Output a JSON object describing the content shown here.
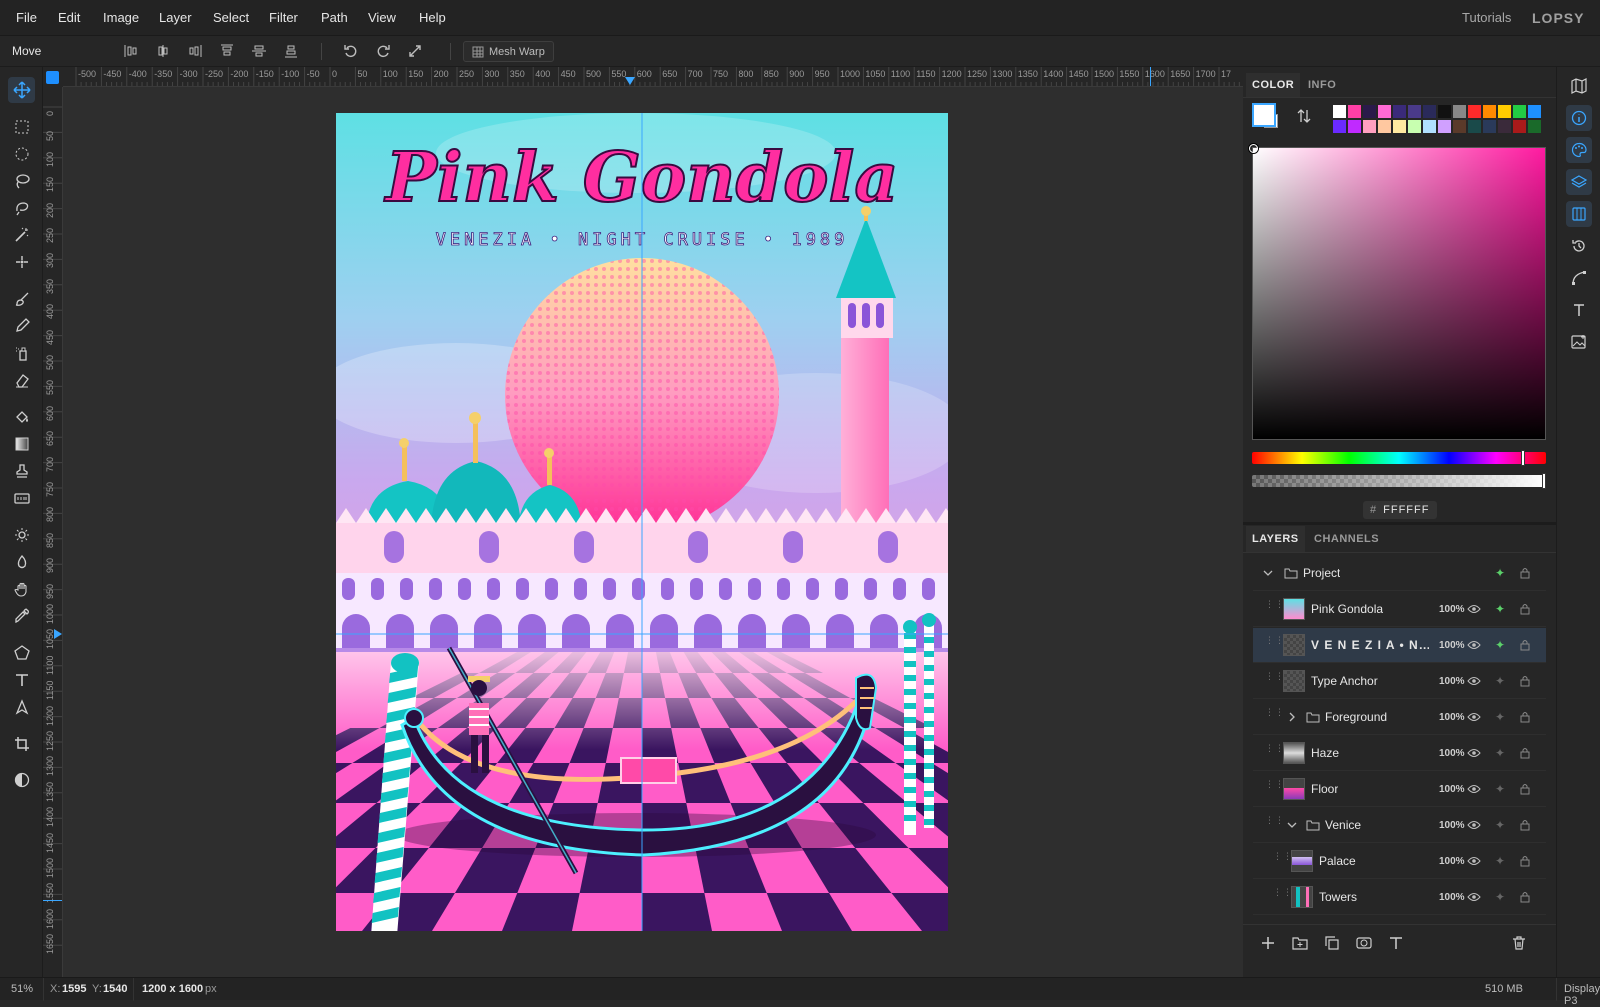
{
  "menu": {
    "items": [
      "File",
      "Edit",
      "Image",
      "Layer",
      "Select",
      "Filter",
      "Path",
      "View",
      "Help"
    ],
    "tutorials": "Tutorials",
    "brand": "LOPSY"
  },
  "options": {
    "tool_name": "Move",
    "mesh_warp": "Mesh Warp"
  },
  "rulers": {
    "h_ticks": [
      "-500",
      "-450",
      "-400",
      "-350",
      "-300",
      "-250",
      "-200",
      "-150",
      "-100",
      "-50",
      "0",
      "50",
      "100",
      "150",
      "200",
      "250",
      "300",
      "350",
      "400",
      "450",
      "500",
      "550",
      "600",
      "650",
      "700",
      "750",
      "800",
      "850",
      "900",
      "950",
      "1000",
      "1050",
      "1100",
      "1150",
      "1200",
      "1250",
      "1300",
      "1350",
      "1400",
      "1450",
      "1500",
      "1550",
      "1600",
      "1650",
      "1700",
      "17"
    ],
    "v_ticks": [
      "0",
      "50",
      "100",
      "150",
      "200",
      "250",
      "300",
      "350",
      "400",
      "450",
      "500",
      "550",
      "600",
      "650",
      "700",
      "750",
      "800",
      "850",
      "900",
      "950",
      "1000",
      "1050",
      "1100",
      "1150",
      "1200",
      "1250",
      "1300",
      "1350",
      "1400",
      "1450",
      "1500",
      "1550",
      "1600",
      "1650"
    ]
  },
  "artwork": {
    "title": "Pink Gondola",
    "subtitle": "VENEZIA • NIGHT CRUISE • 1989"
  },
  "color_panel": {
    "tabs": [
      "COLOR",
      "INFO"
    ],
    "hex_prefix": "#",
    "hex": "FFFFFF",
    "swatches_row1": [
      "#ffffff",
      "#ff3fa6",
      "#2a1a4a",
      "#ff6ad5",
      "#3a2a7a",
      "#4a3a8a",
      "#2a2a5a",
      "#111111",
      "#888888",
      "#ff2a2a",
      "#ff8a00",
      "#ffcc00",
      "#22cc44",
      "#1e90ff"
    ],
    "swatches_row2": [
      "#6a2aff",
      "#c02aff",
      "#ffa0c0",
      "#ffc8a0",
      "#ffeaa0",
      "#c8ffb0",
      "#b0e0ff",
      "#d0a0ff",
      "#5a3a2a",
      "#1a4a4a",
      "#2a3a5a",
      "#3a2a3a",
      "#aa1a1a",
      "#1a6a2a"
    ]
  },
  "layers_panel": {
    "tabs": [
      "LAYERS",
      "CHANNELS"
    ],
    "layers": [
      {
        "name": "Project",
        "opacity": ""
      },
      {
        "name": "Pink Gondola",
        "opacity": "100%"
      },
      {
        "name": "V E N E Z I A  •  N…",
        "opacity": "100%"
      },
      {
        "name": "Type Anchor",
        "opacity": "100%"
      },
      {
        "name": "Foreground",
        "opacity": "100%"
      },
      {
        "name": "Haze",
        "opacity": "100%"
      },
      {
        "name": "Floor",
        "opacity": "100%"
      },
      {
        "name": "Venice",
        "opacity": "100%"
      },
      {
        "name": "Palace",
        "opacity": "100%"
      },
      {
        "name": "Towers",
        "opacity": "100%"
      }
    ]
  },
  "status": {
    "zoom": "51%",
    "x_label": "X:",
    "x": "1595",
    "y_label": "Y:",
    "y": "1540",
    "doc_size": "1200 x 1600",
    "doc_unit": "px",
    "memory": "510 MB",
    "display": "Display P3"
  },
  "colors": {
    "accent": "#3aa6ff",
    "pink": "#ff2ea0",
    "teal": "#12c2c2",
    "purple": "#8a55d8",
    "dark_purple": "#2a1040"
  }
}
